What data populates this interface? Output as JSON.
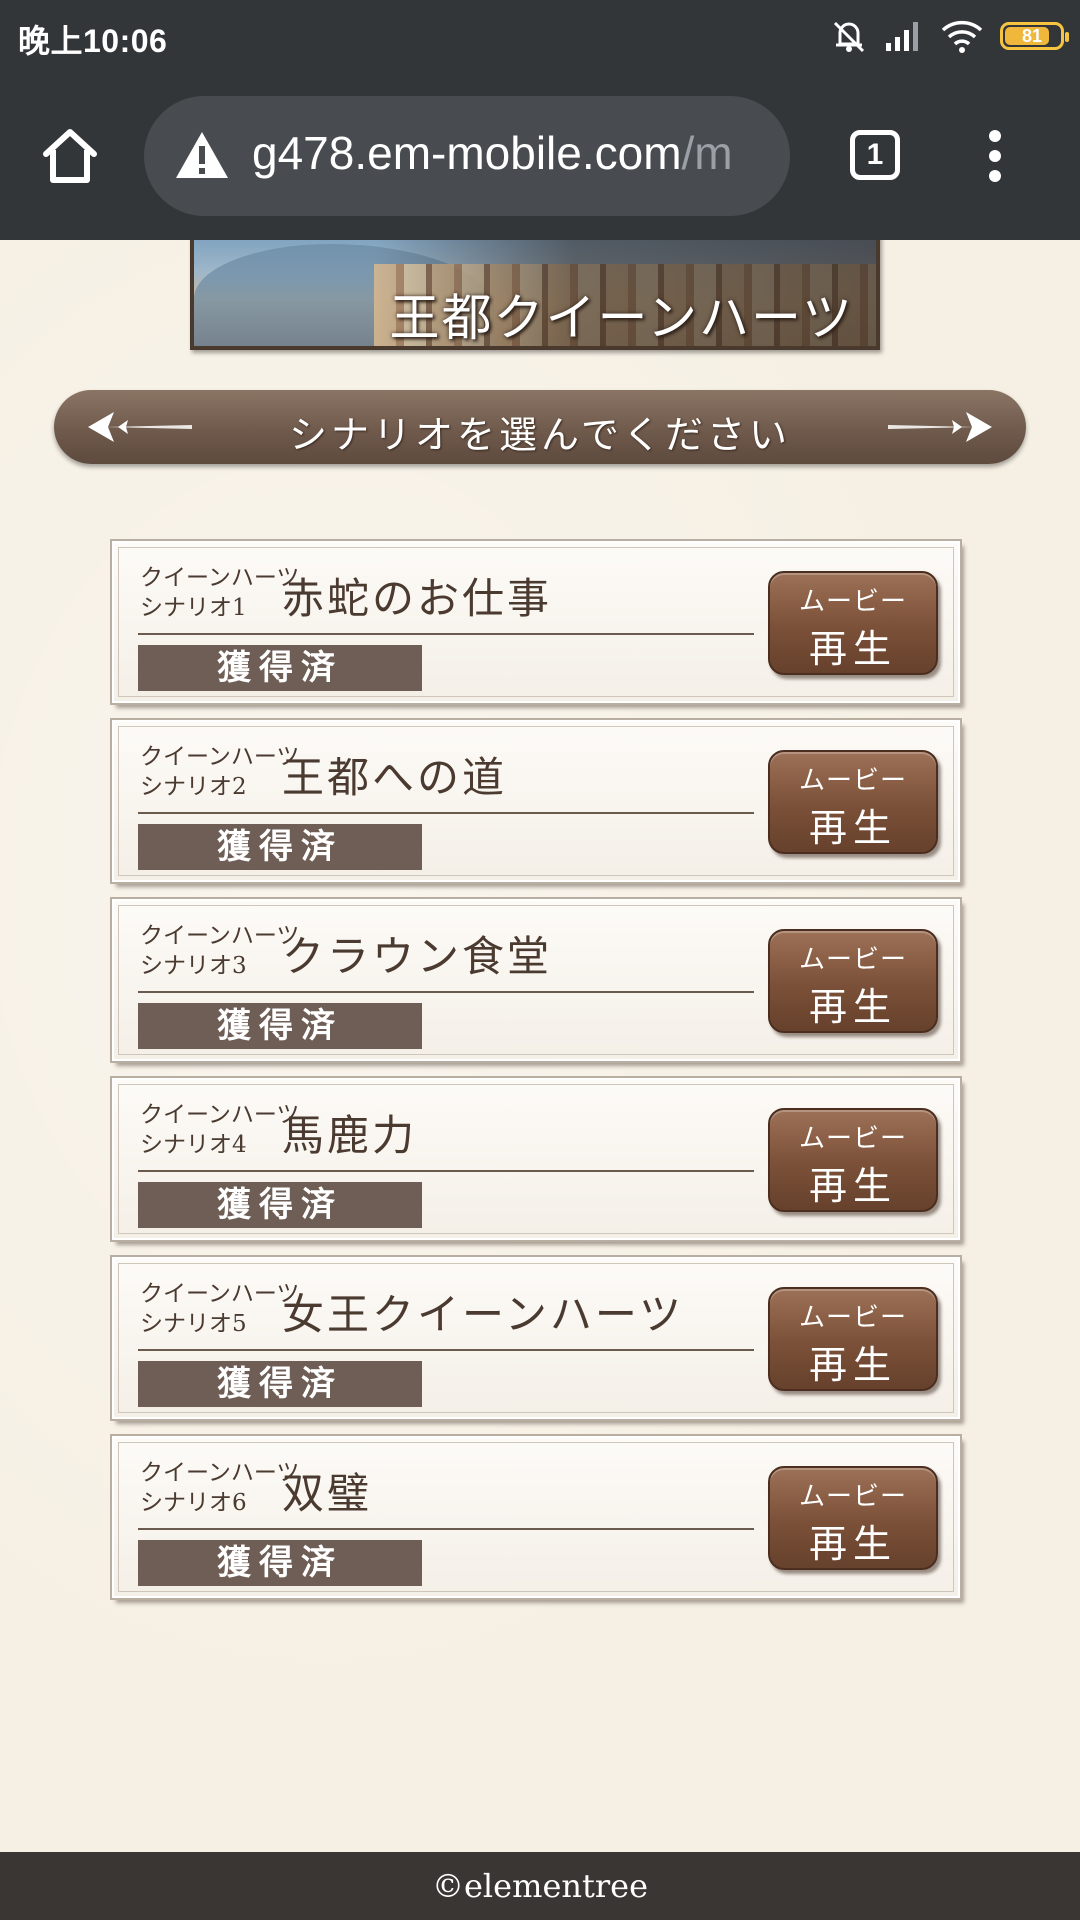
{
  "status_bar": {
    "time": "晚上10:06",
    "battery": "81"
  },
  "browser": {
    "url_main": "g478.em-mobile.com",
    "url_faded": "/m",
    "tab_count": "1"
  },
  "banner": {
    "title": "王都クイーンハーツ"
  },
  "header": {
    "title": "シナリオを選んでください"
  },
  "scenarios": [
    {
      "series_line1": "クイーンハーツ",
      "series_line2": "シナリオ1",
      "title": "赤蛇のお仕事",
      "status": "獲得済",
      "movie_line1": "ムービー",
      "movie_line2": "再生"
    },
    {
      "series_line1": "クイーンハーツ",
      "series_line2": "シナリオ2",
      "title": "王都への道",
      "status": "獲得済",
      "movie_line1": "ムービー",
      "movie_line2": "再生"
    },
    {
      "series_line1": "クイーンハーツ",
      "series_line2": "シナリオ3",
      "title": "クラウン食堂",
      "status": "獲得済",
      "movie_line1": "ムービー",
      "movie_line2": "再生"
    },
    {
      "series_line1": "クイーンハーツ",
      "series_line2": "シナリオ4",
      "title": "馬鹿力",
      "status": "獲得済",
      "movie_line1": "ムービー",
      "movie_line2": "再生"
    },
    {
      "series_line1": "クイーンハーツ",
      "series_line2": "シナリオ5",
      "title": "女王クイーンハーツ",
      "status": "獲得済",
      "movie_line1": "ムービー",
      "movie_line2": "再生"
    },
    {
      "series_line1": "クイーンハーツ",
      "series_line2": "シナリオ6",
      "title": "双璧",
      "status": "獲得済",
      "movie_line1": "ムービー",
      "movie_line2": "再生"
    }
  ],
  "footer": {
    "text": "©elementree"
  }
}
